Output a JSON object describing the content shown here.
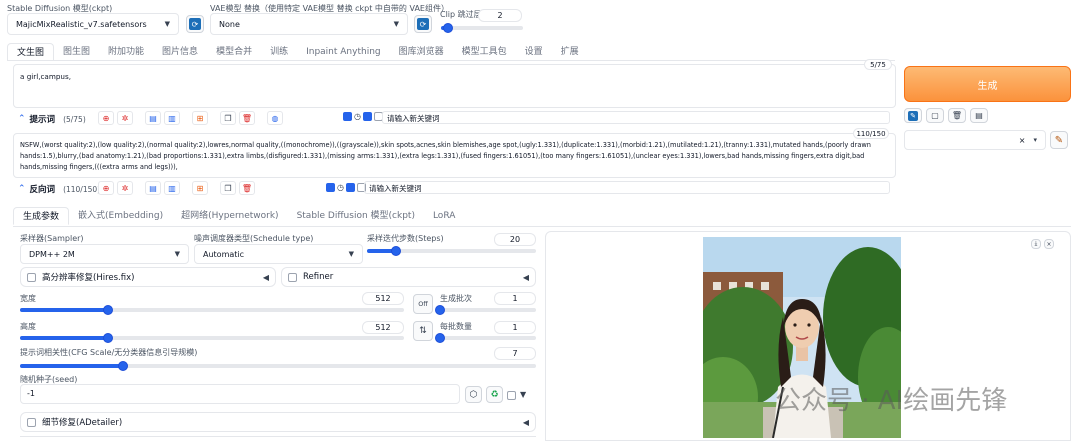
{
  "checkpoint": {
    "label": "Stable Diffusion 模型(ckpt)",
    "value": "MajicMixRealistic_v7.safetensors"
  },
  "vae": {
    "label": "VAE模型 替换（使用特定 VAE模型 替换 ckpt 中自带的 VAE组件）",
    "value": "None"
  },
  "clip": {
    "label": "Clip 跳过层",
    "value": "2",
    "fraction": 0.08
  },
  "main_tabs": [
    "文生图",
    "图生图",
    "附加功能",
    "图片信息",
    "模型合并",
    "训练",
    "Inpaint Anything",
    "图库浏览器",
    "模型工具包",
    "设置",
    "扩展"
  ],
  "prompt": {
    "text": "a girl,campus,",
    "counter": "5/75",
    "label": "提示词",
    "count": "(5/75)",
    "keyword_placeholder": "请输入新关键词"
  },
  "negative": {
    "text": "NSFW,(worst quality:2),(low quality:2),(normal quality:2),lowres,normal quality,((monochrome)),((grayscale)),skin spots,acnes,skin blemishes,age spot,(ugly:1.331),(duplicate:1.331),(morbid:1.21),(mutilated:1.21),(tranny:1.331),mutated hands,(poorly drawn hands:1.5),blurry,(bad anatomy:1.21),(bad proportions:1.331),extra limbs,(disfigured:1.331),(missing arms:1.331),(extra legs:1.331),(fused fingers:1.61051),(too many fingers:1.61051),(unclear eyes:1.331),lowers,bad hands,missing fingers,extra digit,bad hands,missing fingers,(((extra arms and legs))),",
    "counter": "110/150",
    "label": "反向词",
    "count": "(110/150)",
    "keyword_placeholder": "请输入新关键词"
  },
  "generate_label": "生成",
  "sub_tabs": [
    "生成参数",
    "嵌入式(Embedding)",
    "超网络(Hypernetwork)",
    "Stable Diffusion 模型(ckpt)",
    "LoRA"
  ],
  "sampler": {
    "label": "采样器(Sampler)",
    "value": "DPM++ 2M"
  },
  "schedule": {
    "label": "噪声调度器类型(Schedule type)",
    "value": "Automatic"
  },
  "steps": {
    "label": "采样迭代步数(Steps)",
    "value": "20",
    "fraction": 0.17
  },
  "hires": {
    "label": "高分辨率修复(Hires.fix)"
  },
  "refiner": {
    "label": "Refiner"
  },
  "width": {
    "label": "宽度",
    "value": "512",
    "fraction": 0.23
  },
  "height": {
    "label": "高度",
    "value": "512",
    "fraction": 0.23
  },
  "swap_label": "Off",
  "batch_count": {
    "label": "生成批次",
    "value": "1",
    "fraction": 0.0
  },
  "batch_size": {
    "label": "每批数量",
    "value": "1",
    "fraction": 0.0
  },
  "cfg": {
    "label": "提示词相关性(CFG Scale/无分类器信息引导规模)",
    "value": "7",
    "fraction": 0.2
  },
  "seed": {
    "label": "随机种子(seed)",
    "value": "-1"
  },
  "adetailer": {
    "label": "细节修复(ADetailer)"
  },
  "watermark": "公众号 · AI绘画先锋",
  "colors": {
    "accent": "#2563eb",
    "generate": "#fb923c",
    "tab_active_border": "#e5e7eb"
  }
}
